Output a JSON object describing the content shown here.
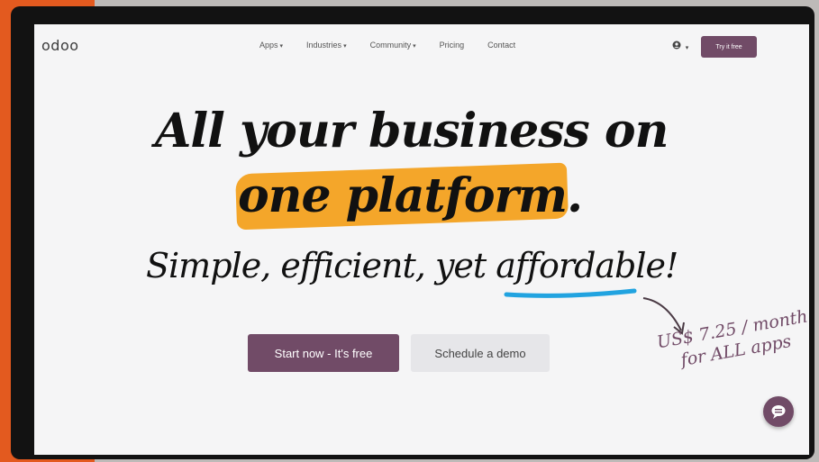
{
  "nav": {
    "logo": "odoo",
    "menu": [
      {
        "label": "Apps",
        "dropdown": true
      },
      {
        "label": "Industries",
        "dropdown": true
      },
      {
        "label": "Community",
        "dropdown": true
      },
      {
        "label": "Pricing",
        "dropdown": false
      },
      {
        "label": "Contact",
        "dropdown": false
      }
    ],
    "caret": "▾",
    "user_icon": "user-circle-icon",
    "try_button": "Try it free"
  },
  "hero": {
    "headline_line1": "All your business on",
    "headline_line2": "one platform.",
    "subheadline": "Simple, efficient, yet affordable!",
    "start_button": "Start now - It's free",
    "demo_button": "Schedule a demo",
    "price_line1": "US$ 7.25 / month",
    "price_line2": "for ALL apps"
  },
  "colors": {
    "brand": "#714b67",
    "highlight": "#f4a62a",
    "underline": "#21a3e0"
  },
  "chat_icon": "chat-bubble-icon"
}
